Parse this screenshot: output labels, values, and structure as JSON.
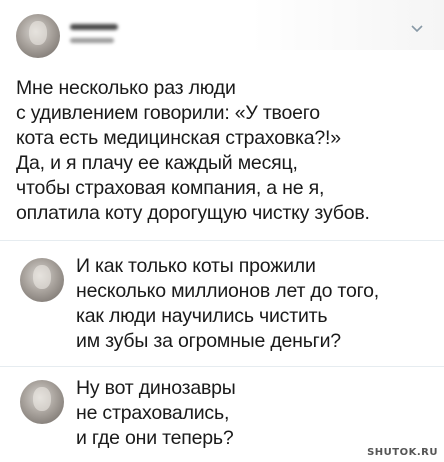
{
  "tweet": {
    "text": "Мне несколько раз люди\nс удивлением говорили: «У твоего\nкота есть медицинская страховка?!»\nДа, и я плачу ее каждый месяц,\nчтобы страховая компания, а не я,\nоплатила коту дорогущую чистку зубов.",
    "menu_icon": "chevron-down-icon"
  },
  "replies": [
    {
      "text": "И как только коты прожили\nнесколько миллионов лет до того,\nкак люди научились чистить\nим зубы за огромные деньги?"
    },
    {
      "text": "Ну вот динозавры\nне страховались,\nи где они теперь?"
    }
  ],
  "watermark": "SHUTOK.RU"
}
